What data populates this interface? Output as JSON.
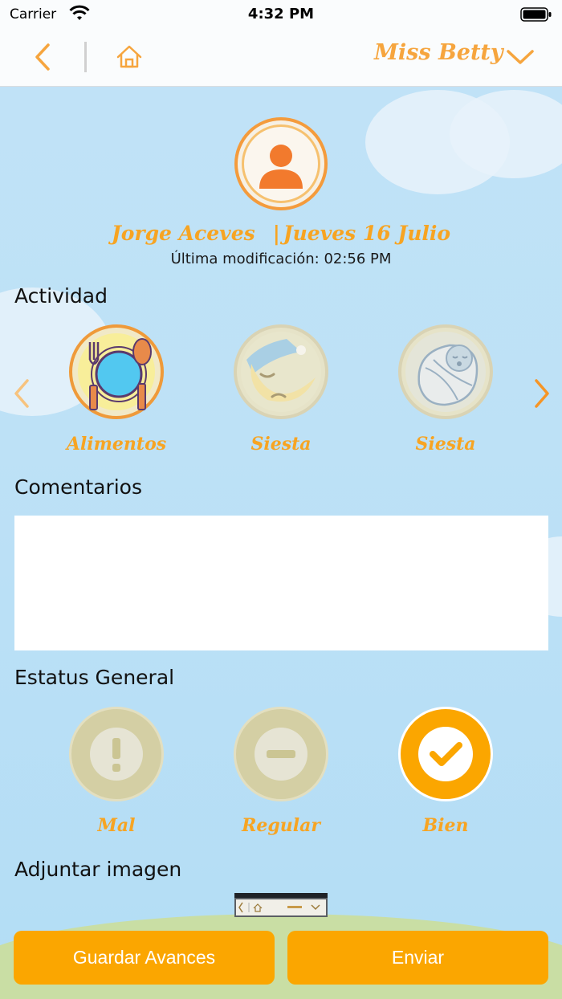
{
  "status_bar": {
    "carrier": "Carrier",
    "time": "4:32 PM"
  },
  "nav": {
    "teacher_name": "Miss Betty"
  },
  "child": {
    "name": "Jorge Aceves",
    "separator": "|",
    "date": "Jueves 16 Julio",
    "last_modified": "Última modificación: 02:56 PM"
  },
  "activity": {
    "label": "Actividad",
    "items": [
      {
        "label": "Alimentos",
        "icon": "food-plate-icon",
        "selected": true
      },
      {
        "label": "Siesta",
        "icon": "moon-sleep-icon",
        "selected": false
      },
      {
        "label": "Siesta",
        "icon": "baby-sleep-icon",
        "selected": false
      }
    ]
  },
  "comments": {
    "label": "Comentarios",
    "value": ""
  },
  "status": {
    "label": "Estatus General",
    "options": [
      {
        "label": "Mal",
        "icon": "exclamation-icon",
        "selected": false
      },
      {
        "label": "Regular",
        "icon": "minus-icon",
        "selected": false
      },
      {
        "label": "Bien",
        "icon": "check-icon",
        "selected": true
      }
    ]
  },
  "attach": {
    "label": "Adjuntar imagen"
  },
  "buttons": {
    "save": "Guardar Avances",
    "send": "Enviar"
  },
  "colors": {
    "accent": "#fba600",
    "accent_text": "#f7a422",
    "avatar": "#f27a2d",
    "inactive_circle": "#d4cfa4",
    "sky": "#bde1f6"
  }
}
